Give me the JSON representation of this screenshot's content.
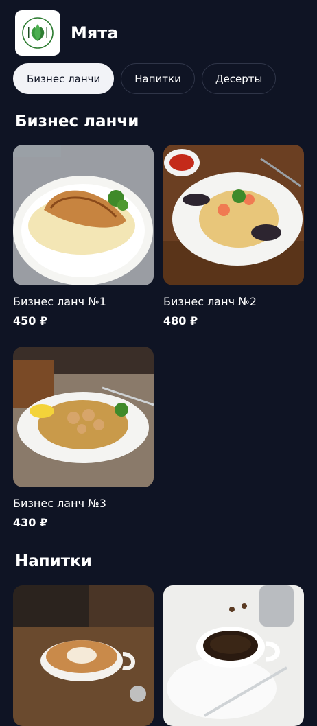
{
  "app": {
    "name": "Мята"
  },
  "tabs": [
    {
      "label": "Бизнес ланчи",
      "active": true
    },
    {
      "label": "Напитки",
      "active": false
    },
    {
      "label": "Десерты",
      "active": false
    }
  ],
  "sections": [
    {
      "title": "Бизнес ланчи",
      "items": [
        {
          "name": "Бизнес ланч №1",
          "price": "450 ₽"
        },
        {
          "name": "Бизнес ланч №2",
          "price": "480 ₽"
        },
        {
          "name": "Бизнес ланч №3",
          "price": "430 ₽"
        }
      ]
    },
    {
      "title": "Напитки",
      "items": []
    }
  ],
  "colors": {
    "background": "#0f1424",
    "tab_active_bg": "#f2f3f7",
    "tab_border": "#2f3548"
  }
}
